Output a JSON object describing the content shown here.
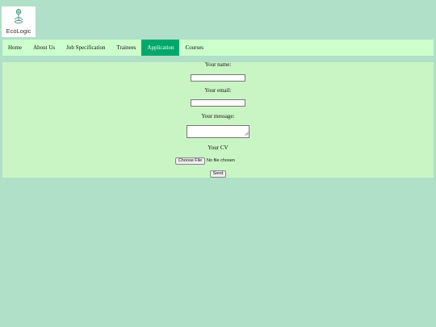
{
  "logo": {
    "text": "EcoLogic",
    "icon": "tree-ring-icon"
  },
  "nav": {
    "items": [
      {
        "label": "Home"
      },
      {
        "label": "About Us"
      },
      {
        "label": "Job Specification"
      },
      {
        "label": "Trainees"
      },
      {
        "label": "Application",
        "active": true
      },
      {
        "label": "Courses"
      }
    ]
  },
  "form": {
    "name_label": "Your name:",
    "email_label": "Your email:",
    "message_label": "Your message:",
    "cv_label": "Your CV",
    "file_button": "Choose File",
    "file_status": "No file chosen",
    "send_button": "Send"
  },
  "colors": {
    "page_background": "#b0e0c8",
    "nav_background": "#ccffcc",
    "nav_active": "#00a86b",
    "form_background": "#c9f5c4"
  }
}
